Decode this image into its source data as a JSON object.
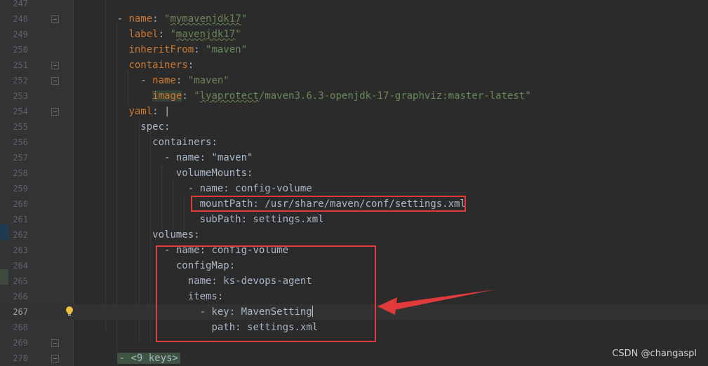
{
  "editor": {
    "lines": [
      {
        "n": "247",
        "indent": "",
        "text": ""
      },
      {
        "n": "248",
        "indent": "      ",
        "tokens": [
          [
            "kp",
            "- "
          ],
          [
            "k",
            "name"
          ],
          [
            "kp",
            ": "
          ],
          [
            "s",
            "\""
          ],
          [
            "sq",
            "mymavenjdk17"
          ],
          [
            "s",
            "\""
          ]
        ]
      },
      {
        "n": "249",
        "indent": "        ",
        "tokens": [
          [
            "k",
            "label"
          ],
          [
            "kp",
            ": "
          ],
          [
            "s",
            "\""
          ],
          [
            "sq",
            "mavenjdk17"
          ],
          [
            "s",
            "\""
          ]
        ]
      },
      {
        "n": "250",
        "indent": "        ",
        "tokens": [
          [
            "k",
            "inheritFrom"
          ],
          [
            "kp",
            ": "
          ],
          [
            "s",
            "\"maven\""
          ]
        ]
      },
      {
        "n": "251",
        "indent": "        ",
        "tokens": [
          [
            "k",
            "containers"
          ],
          [
            "kp",
            ":"
          ]
        ]
      },
      {
        "n": "252",
        "indent": "          ",
        "tokens": [
          [
            "kp",
            "- "
          ],
          [
            "k",
            "name"
          ],
          [
            "kp",
            ": "
          ],
          [
            "s",
            "\"maven\""
          ]
        ]
      },
      {
        "n": "253",
        "indent": "            ",
        "tokens": [
          [
            "hk",
            "image"
          ],
          [
            "kp",
            ": "
          ],
          [
            "s",
            "\""
          ],
          [
            "sq",
            "lyaprotect"
          ],
          [
            "s",
            "/maven3.6.3-openjdk-17-graphviz:master-latest\""
          ]
        ]
      },
      {
        "n": "254",
        "indent": "        ",
        "tokens": [
          [
            "k",
            "yaml"
          ],
          [
            "kp",
            ": |"
          ]
        ]
      },
      {
        "n": "255",
        "indent": "          ",
        "tokens": [
          [
            "v",
            "spec:"
          ]
        ]
      },
      {
        "n": "256",
        "indent": "            ",
        "tokens": [
          [
            "v",
            "containers:"
          ]
        ]
      },
      {
        "n": "257",
        "indent": "              ",
        "tokens": [
          [
            "v",
            "- name: \"maven\""
          ]
        ]
      },
      {
        "n": "258",
        "indent": "                ",
        "tokens": [
          [
            "v",
            "volumeMounts:"
          ]
        ]
      },
      {
        "n": "259",
        "indent": "                  ",
        "tokens": [
          [
            "v",
            "- name: config-volume"
          ]
        ]
      },
      {
        "n": "260",
        "indent": "                    ",
        "tokens": [
          [
            "v",
            "mountPath: /usr/share/maven/conf/settings.xml"
          ]
        ]
      },
      {
        "n": "261",
        "indent": "                    ",
        "tokens": [
          [
            "v",
            "subPath: settings.xml"
          ]
        ]
      },
      {
        "n": "262",
        "indent": "            ",
        "tokens": [
          [
            "v",
            "volumes:"
          ]
        ]
      },
      {
        "n": "263",
        "indent": "              ",
        "tokens": [
          [
            "v",
            "- name: config-volume"
          ]
        ]
      },
      {
        "n": "264",
        "indent": "                ",
        "tokens": [
          [
            "v",
            "configMap:"
          ]
        ]
      },
      {
        "n": "265",
        "indent": "                  ",
        "tokens": [
          [
            "v",
            "name: ks-devops-agent"
          ]
        ]
      },
      {
        "n": "266",
        "indent": "                  ",
        "tokens": [
          [
            "v",
            "items:"
          ]
        ]
      },
      {
        "n": "267",
        "indent": "                    ",
        "tokens": [
          [
            "v",
            "- key: MavenSetting"
          ]
        ],
        "current": true
      },
      {
        "n": "268",
        "indent": "                      ",
        "tokens": [
          [
            "v",
            "path: settings.xml"
          ]
        ]
      },
      {
        "n": "269",
        "indent": "",
        "tokens": []
      },
      {
        "n": "270",
        "indent": "      ",
        "tokens": [
          [
            "fold",
            "- <9 keys>"
          ]
        ]
      }
    ]
  },
  "watermark": "CSDN @changaspl",
  "colors": {
    "annotation": "#e03a3a",
    "keyword": "#cc7832",
    "string": "#6a8759"
  }
}
